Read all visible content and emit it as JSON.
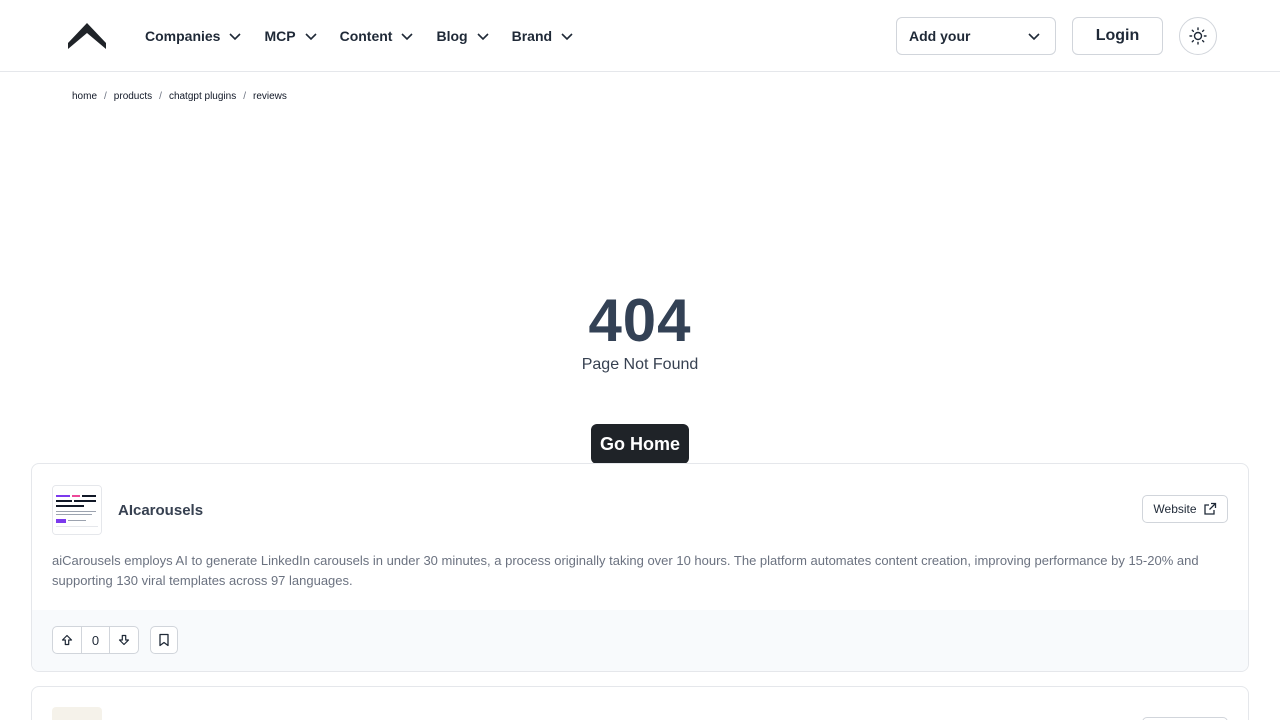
{
  "header": {
    "nav": [
      {
        "label": "Companies"
      },
      {
        "label": "MCP"
      },
      {
        "label": "Content"
      },
      {
        "label": "Blog"
      },
      {
        "label": "Brand"
      }
    ],
    "add_select": {
      "value": "Add your"
    },
    "login_label": "Login"
  },
  "breadcrumb": [
    "home",
    "products",
    "chatgpt plugins",
    "reviews"
  ],
  "error": {
    "code": "404",
    "message": "Page Not Found",
    "go_home_label": "Go Home"
  },
  "cards": [
    {
      "title": "AIcarousels",
      "website_label": "Website",
      "description": "aiCarousels employs AI to generate LinkedIn carousels in under 30 minutes, a process originally taking over 10 hours. The platform automates content creation, improving performance by 15-20% and supporting 130 viral templates across 97 languages.",
      "votes": "0"
    }
  ],
  "colors": {
    "accent_dark": "#1f2328",
    "heading": "#334155",
    "muted": "#6b7280",
    "border": "#e5e7eb"
  },
  "icons": [
    "logo-icon",
    "chevron-down-icon",
    "sun-icon",
    "external-link-icon",
    "arrow-up-icon",
    "arrow-down-icon",
    "bookmark-icon"
  ]
}
